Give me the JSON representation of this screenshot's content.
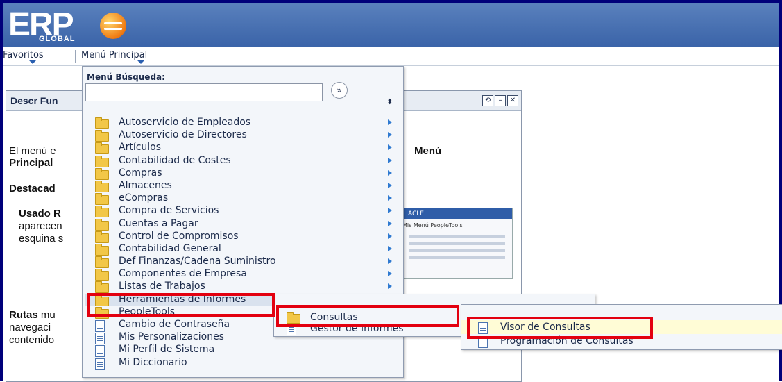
{
  "brand": {
    "logo_text": "ERP",
    "logo_sub": "GLOBAL"
  },
  "menubar": {
    "favorites_label": "Favoritos",
    "main_menu_label": "Menú Principal"
  },
  "panel": {
    "title": "Descr Fun",
    "p1_start": "El menú e",
    "p1_bold": "Principal",
    "p1_right": "Menú",
    "destacado": "Destacad",
    "used_bold": "Usado R",
    "used_l2": "aparecen",
    "used_l3": "esquina s",
    "routes_bold": "Rutas",
    "routes_rest": " mu",
    "routes_l2": "navegaci",
    "routes_l3": "contenido",
    "thumb_brand": "ACLE",
    "thumb_text": "Mis Menú   PeopleTools"
  },
  "search": {
    "label": "Menú Búsqueda:",
    "value": "",
    "go_symbol": "»",
    "sort_symbol": "⬍"
  },
  "menu_items": [
    {
      "label": "Autoservicio de Empleados",
      "icon": "folder-icon",
      "arrow": true
    },
    {
      "label": "Autoservicio de Directores",
      "icon": "folder-icon",
      "arrow": true
    },
    {
      "label": "Artículos",
      "icon": "folder-icon",
      "arrow": true
    },
    {
      "label": "Contabilidad de Costes",
      "icon": "folder-icon",
      "arrow": true
    },
    {
      "label": "Compras",
      "icon": "folder-icon",
      "arrow": true
    },
    {
      "label": "Almacenes",
      "icon": "folder-icon",
      "arrow": true
    },
    {
      "label": "eCompras",
      "icon": "folder-icon",
      "arrow": true
    },
    {
      "label": "Compra de Servicios",
      "icon": "folder-icon",
      "arrow": true
    },
    {
      "label": "Cuentas a Pagar",
      "icon": "folder-icon",
      "arrow": true
    },
    {
      "label": "Control de Compromisos",
      "icon": "folder-icon",
      "arrow": true
    },
    {
      "label": "Contabilidad General",
      "icon": "folder-icon",
      "arrow": true
    },
    {
      "label": "Def Finanzas/Cadena Suministro",
      "icon": "folder-icon",
      "arrow": true
    },
    {
      "label": "Componentes de Empresa",
      "icon": "folder-icon",
      "arrow": true
    },
    {
      "label": "Listas de Trabajos",
      "icon": "folder-icon",
      "arrow": true
    },
    {
      "label": "Herramientas de Informes",
      "icon": "folder-icon",
      "arrow": true
    },
    {
      "label": "PeopleTools",
      "icon": "folder-icon",
      "arrow": true
    },
    {
      "label": "Cambio de Contraseña",
      "icon": "document-icon",
      "arrow": false
    },
    {
      "label": "Mis Personalizaciones",
      "icon": "document-icon",
      "arrow": false
    },
    {
      "label": "Mi Perfil de Sistema",
      "icon": "document-icon",
      "arrow": false
    },
    {
      "label": "Mi Diccionario",
      "icon": "document-icon",
      "arrow": false
    }
  ],
  "submenu_reports": [
    {
      "label": "Consultas",
      "icon": "folder-icon"
    },
    {
      "label": "Gestor de Informes",
      "icon": "document-icon"
    }
  ],
  "submenu_queries": [
    {
      "label": "Visor de Consultas",
      "icon": "document-icon"
    },
    {
      "label": "Programación de Consultas",
      "icon": "document-icon"
    }
  ],
  "colors": {
    "header_blue": "#3a63a8",
    "highlight_red": "#e3000f",
    "menu_bg": "#f3f6fa"
  }
}
